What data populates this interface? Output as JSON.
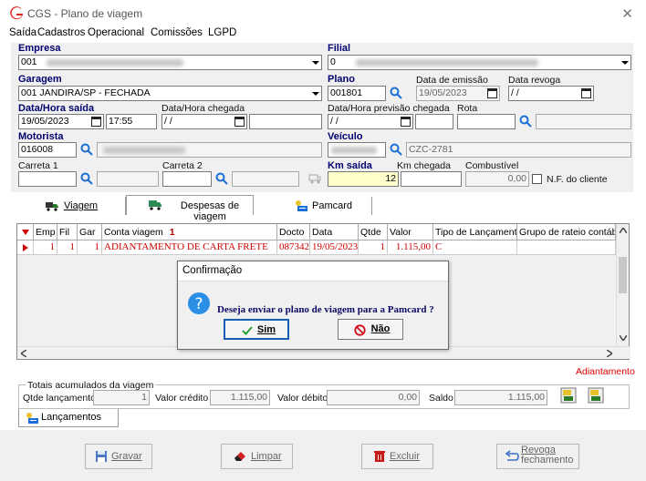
{
  "window": {
    "title": "CGS - Plano de viagem",
    "close_glyph": "✕"
  },
  "menu": [
    "Saída",
    "Cadastros",
    "Operacional",
    "Comissões",
    "LGPD"
  ],
  "form": {
    "empresa": {
      "label": "Empresa",
      "value": "001"
    },
    "filial": {
      "label": "Filial",
      "value": "0"
    },
    "garagem": {
      "label": "Garagem",
      "value": "001 JANDIRA/SP - FECHADA"
    },
    "plano": {
      "label": "Plano",
      "value": "001801"
    },
    "data_emissao": {
      "label": "Data de emissão",
      "value": "19/05/2023"
    },
    "data_revoga": {
      "label": "Data revoga",
      "value": "/ /"
    },
    "data_saida": {
      "label": "Data/Hora saída",
      "date": "19/05/2023",
      "time": "17:55"
    },
    "data_chegada": {
      "label": "Data/Hora chegada",
      "date": "/ /"
    },
    "data_prev": {
      "label": "Data/Hora previsão chegada",
      "date": "/ /"
    },
    "rota": {
      "label": "Rota"
    },
    "motorista": {
      "label": "Motorista",
      "value": "016008"
    },
    "veiculo": {
      "label": "Veículo",
      "plate": "CZC-2781"
    },
    "carreta1": {
      "label": "Carreta 1"
    },
    "carreta2": {
      "label": "Carreta 2"
    },
    "km_saida": {
      "label": "Km saída",
      "value": "12"
    },
    "km_chegada": {
      "label": "Km chegada"
    },
    "combustivel": {
      "label": "Combustível",
      "value": "0,00"
    },
    "nf_cliente": {
      "label": "N.F. do cliente"
    }
  },
  "tabs": [
    "Viagem",
    "Despesas de viagem",
    "Pamcard"
  ],
  "grid": {
    "headers": [
      "Emp",
      "Fil",
      "Gar",
      "Conta viagem",
      "Docto",
      "Data",
      "Qtde",
      "Valor",
      "Tipo de Lançamento",
      "Grupo de rateio contábil"
    ],
    "sort_indicator": "1",
    "rows": [
      [
        "1",
        "1",
        "1",
        "ADIANTAMENTO DE CARTA FRETE",
        "087342",
        "19/05/2023",
        "1",
        "1.115,00",
        "C",
        ""
      ]
    ]
  },
  "dialog": {
    "title": "Confirmação",
    "message": "Deseja enviar o plano de viagem para a Pamcard ?",
    "yes": "Sim",
    "no": "Não"
  },
  "status_label": "Adiantamento",
  "totals": {
    "legend": "Totais acumulados da viagem",
    "qtde_label": "Qtde lançamento",
    "qtde_value": "1",
    "credito_label": "Valor crédito",
    "credito_value": "1.115,00",
    "debito_label": "Valor débito",
    "debito_value": "0,00",
    "saldo_label": "Saldo",
    "saldo_value": "1.115,00"
  },
  "bottom_tab": "Lançamentos",
  "buttons": {
    "gravar": "Gravar",
    "limpar": "Limpar",
    "excluir": "Excluir",
    "revoga_1": "Revoga",
    "revoga_2": "fechamento"
  },
  "colors": {
    "accent": "#1a5fb4",
    "label_navy": "#00006e",
    "row_red": "#d00000",
    "km_yellow": "#ffffcc"
  }
}
